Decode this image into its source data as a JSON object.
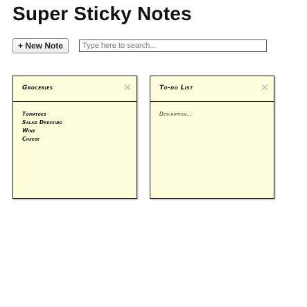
{
  "app": {
    "title": "Super Sticky Notes"
  },
  "toolbar": {
    "new_note_label": "+ New Note",
    "search_placeholder": "Type here to search..."
  },
  "notes": [
    {
      "title": "Groceries",
      "lines": [
        "Tomatoes",
        "Salad Dressing",
        "Wine",
        "Cheese"
      ],
      "close_icon": "close-x-icon"
    },
    {
      "title": "To-do List",
      "placeholder": "Description...",
      "close_icon": "close-x-icon"
    }
  ],
  "colors": {
    "note_background": "#fefdda",
    "note_border": "#1c1c1c",
    "close_icon": "#bdbdbd"
  }
}
